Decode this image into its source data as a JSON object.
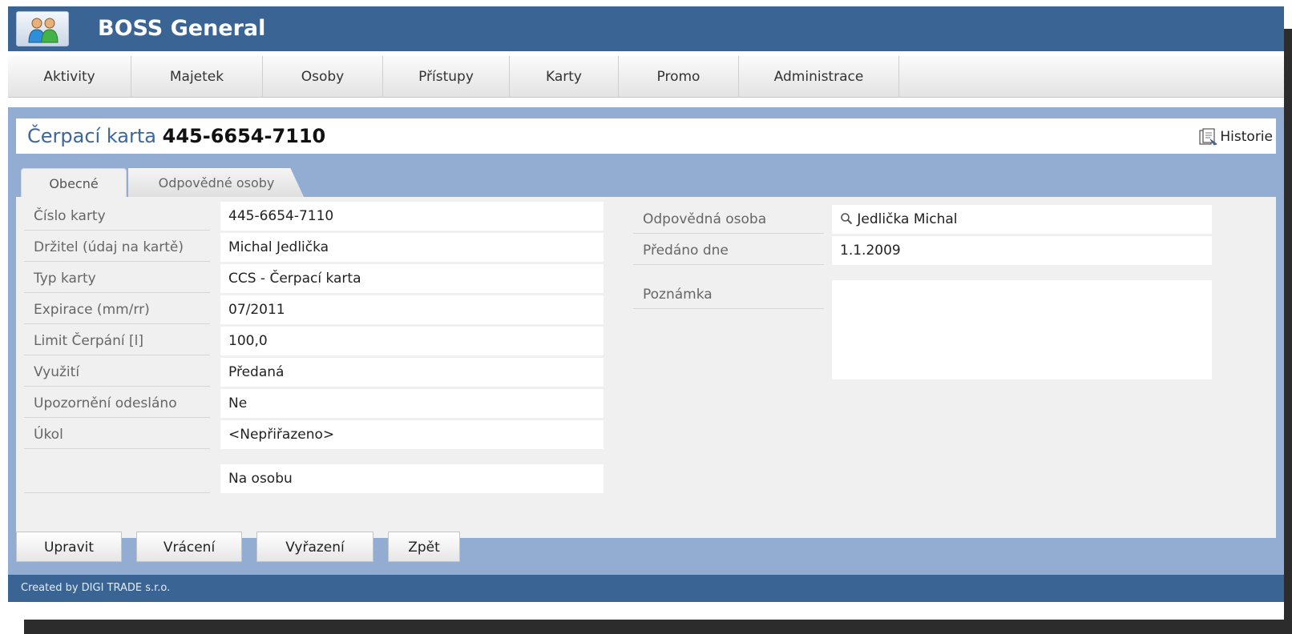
{
  "app": {
    "title": "BOSS General"
  },
  "menu": {
    "items": [
      "Aktivity",
      "Majetek",
      "Osoby",
      "Přístupy",
      "Karty",
      "Promo",
      "Administrace"
    ]
  },
  "page": {
    "title_label": "Čerpací karta",
    "title_number": "445-6654-7110",
    "history_label": "Historie"
  },
  "tabs": [
    {
      "label": "Obecné",
      "active": true
    },
    {
      "label": "Odpovědné osoby",
      "active": false
    }
  ],
  "form_left": [
    {
      "label": "Číslo karty",
      "value": "445-6654-7110"
    },
    {
      "label": "Držitel (údaj na kartě)",
      "value": "Michal Jedlička"
    },
    {
      "label": "Typ karty",
      "value": "CCS - Čerpací karta"
    },
    {
      "label": "Expirace (mm/rr)",
      "value": "07/2011"
    },
    {
      "label": "Limit Čerpání [l]",
      "value": "100,0"
    },
    {
      "label": "Využití",
      "value": "Předaná"
    },
    {
      "label": "Upozornění odesláno",
      "value": "Ne"
    },
    {
      "label": "Úkol",
      "value": "<Nepřiřazeno>"
    }
  ],
  "form_left_extra": {
    "label": "",
    "value": "Na osobu"
  },
  "form_right": [
    {
      "label": "Odpovědná osoba",
      "value": "Jedlička Michal",
      "icon": "search-icon"
    },
    {
      "label": "Předáno dne",
      "value": "1.1.2009"
    }
  ],
  "note": {
    "label": "Poznámka",
    "value": ""
  },
  "buttons": {
    "edit": "Upravit",
    "return": "Vrácení",
    "discard": "Vyřazení",
    "back": "Zpět"
  },
  "footer": {
    "text": "Created by DIGI TRADE s.r.o."
  },
  "colors": {
    "header": "#3a6494",
    "panel": "#93acd1",
    "title_accent": "#3b679d"
  }
}
